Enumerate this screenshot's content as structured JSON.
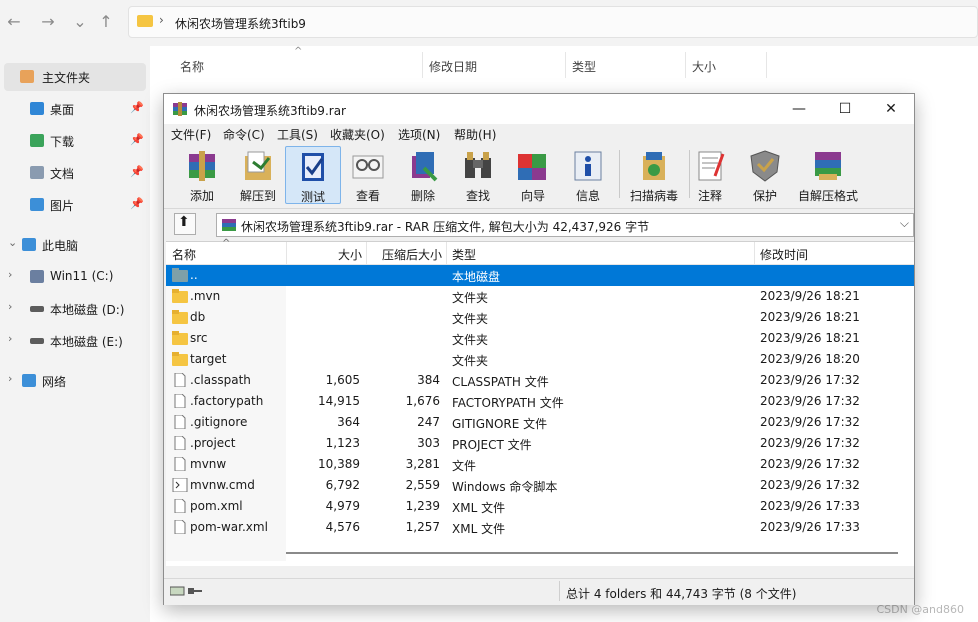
{
  "explorer": {
    "nav": {
      "back": "←",
      "forward": "→",
      "down": "⌄",
      "up": "↑"
    },
    "address": {
      "separator": "›",
      "path": "休闲农场管理系统3ftib9"
    },
    "sidebar": [
      {
        "label": "主文件夹",
        "icon": "home-icon"
      },
      {
        "label": "桌面",
        "icon": "desktop-icon",
        "pin": "📌"
      },
      {
        "label": "下载",
        "icon": "download-icon",
        "pin": "📌"
      },
      {
        "label": "文档",
        "icon": "document-icon",
        "pin": "📌"
      },
      {
        "label": "图片",
        "icon": "picture-icon",
        "pin": "📌"
      },
      {
        "label": "此电脑",
        "icon": "computer-icon",
        "chev": "⌄"
      },
      {
        "label": "Win11 (C:)",
        "icon": "drive-icon",
        "chev": "›"
      },
      {
        "label": "本地磁盘 (D:)",
        "icon": "drive-icon",
        "chev": "›"
      },
      {
        "label": "本地磁盘 (E:)",
        "icon": "drive-icon",
        "chev": "›"
      },
      {
        "label": "网络",
        "icon": "network-icon",
        "chev": "›"
      }
    ],
    "columns": [
      "名称",
      "修改日期",
      "类型",
      "大小"
    ],
    "sort_arrow": "^",
    "watermark": "CSDN @and860"
  },
  "rar": {
    "title": "休闲农场管理系统3ftib9.rar",
    "controls": {
      "minimize": "—",
      "maximize": "☐",
      "close": "✕"
    },
    "menu": [
      "文件(F)",
      "命令(C)",
      "工具(S)",
      "收藏夹(O)",
      "选项(N)",
      "帮助(H)"
    ],
    "toolbar": [
      {
        "label": "添加",
        "icon": "add-icon"
      },
      {
        "label": "解压到",
        "icon": "extract-icon"
      },
      {
        "label": "测试",
        "icon": "test-icon"
      },
      {
        "label": "查看",
        "icon": "view-icon"
      },
      {
        "label": "删除",
        "icon": "delete-icon"
      },
      {
        "label": "查找",
        "icon": "find-icon"
      },
      {
        "label": "向导",
        "icon": "wizard-icon"
      },
      {
        "label": "信息",
        "icon": "info-icon"
      },
      {
        "label": "扫描病毒",
        "icon": "virus-scan-icon"
      },
      {
        "label": "注释",
        "icon": "comment-icon"
      },
      {
        "label": "保护",
        "icon": "protect-icon"
      },
      {
        "label": "自解压格式",
        "icon": "sfx-icon"
      }
    ],
    "path_text": "休闲农场管理系统3ftib9.rar - RAR 压缩文件, 解包大小为 42,437,926 字节",
    "path_dropdown": "⌵",
    "up_arrow": "⬆",
    "headers": {
      "name": "名称",
      "size": "大小",
      "packed": "压缩后大小",
      "type": "类型",
      "modified": "修改时间"
    },
    "header_sort_arrow": "^",
    "rows": [
      {
        "name": "..",
        "size": "",
        "packed": "",
        "type": "本地磁盘",
        "modified": "",
        "icon": "folder-up-icon",
        "selected": true
      },
      {
        "name": ".mvn",
        "size": "",
        "packed": "",
        "type": "文件夹",
        "modified": "2023/9/26 18:21",
        "icon": "folder-icon"
      },
      {
        "name": "db",
        "size": "",
        "packed": "",
        "type": "文件夹",
        "modified": "2023/9/26 18:21",
        "icon": "folder-icon"
      },
      {
        "name": "src",
        "size": "",
        "packed": "",
        "type": "文件夹",
        "modified": "2023/9/26 18:21",
        "icon": "folder-icon"
      },
      {
        "name": "target",
        "size": "",
        "packed": "",
        "type": "文件夹",
        "modified": "2023/9/26 18:20",
        "icon": "folder-icon"
      },
      {
        "name": ".classpath",
        "size": "1,605",
        "packed": "384",
        "type": "CLASSPATH 文件",
        "modified": "2023/9/26 17:32",
        "icon": "file-icon"
      },
      {
        "name": ".factorypath",
        "size": "14,915",
        "packed": "1,676",
        "type": "FACTORYPATH 文件",
        "modified": "2023/9/26 17:32",
        "icon": "file-icon"
      },
      {
        "name": ".gitignore",
        "size": "364",
        "packed": "247",
        "type": "GITIGNORE 文件",
        "modified": "2023/9/26 17:32",
        "icon": "file-icon"
      },
      {
        "name": ".project",
        "size": "1,123",
        "packed": "303",
        "type": "PROJECT 文件",
        "modified": "2023/9/26 17:32",
        "icon": "file-icon"
      },
      {
        "name": "mvnw",
        "size": "10,389",
        "packed": "3,281",
        "type": "文件",
        "modified": "2023/9/26 17:32",
        "icon": "file-icon"
      },
      {
        "name": "mvnw.cmd",
        "size": "6,792",
        "packed": "2,559",
        "type": "Windows 命令脚本",
        "modified": "2023/9/26 17:32",
        "icon": "script-icon"
      },
      {
        "name": "pom.xml",
        "size": "4,979",
        "packed": "1,239",
        "type": "XML 文件",
        "modified": "2023/9/26 17:33",
        "icon": "file-icon"
      },
      {
        "name": "pom-war.xml",
        "size": "4,576",
        "packed": "1,257",
        "type": "XML 文件",
        "modified": "2023/9/26 17:33",
        "icon": "file-icon"
      }
    ],
    "status": "总计 4 folders 和 44,743 字节 (8 个文件)"
  },
  "colors": {
    "selection": "#0078d7",
    "folder": "#f5c542",
    "active_tool": "#d5e7f8"
  }
}
